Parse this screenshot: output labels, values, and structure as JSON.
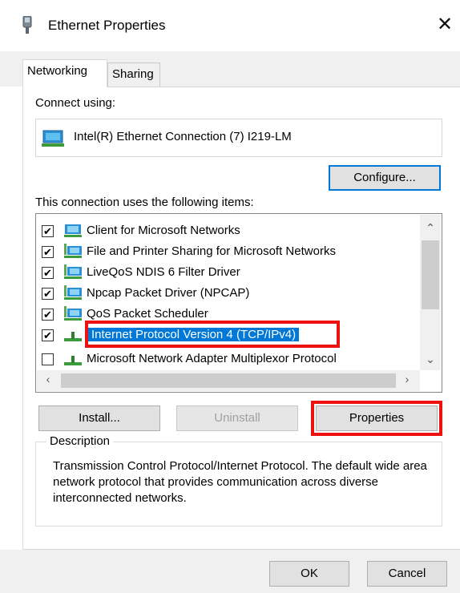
{
  "window": {
    "title": "Ethernet Properties",
    "close_glyph": "✕",
    "title_icon": "network-adapter-icon"
  },
  "tabs": [
    {
      "label": "Networking",
      "active": true
    },
    {
      "label": "Sharing",
      "active": false
    }
  ],
  "connect_using": {
    "label": "Connect using:",
    "adapter_name": "Intel(R) Ethernet Connection (7) I219-LM",
    "icon": "network-adapter-icon"
  },
  "configure_button": "Configure...",
  "items_label": "This connection uses the following items:",
  "items": [
    {
      "label": "Client for Microsoft Networks",
      "checked": true,
      "checkmark": "✔",
      "icon": "network-client-icon"
    },
    {
      "label": "File and Printer Sharing for Microsoft Networks",
      "checked": true,
      "checkmark": "✔",
      "icon": "network-service-icon"
    },
    {
      "label": "LiveQoS NDIS 6 Filter Driver",
      "checked": true,
      "checkmark": "✔",
      "icon": "network-service-icon"
    },
    {
      "label": "Npcap Packet Driver (NPCAP)",
      "checked": true,
      "checkmark": "✔",
      "icon": "network-service-icon"
    },
    {
      "label": "QoS Packet Scheduler",
      "checked": true,
      "checkmark": "✔",
      "icon": "network-service-icon"
    },
    {
      "label": "Internet Protocol Version 4 (TCP/IPv4)",
      "checked": true,
      "checkmark": "✔",
      "selected": true,
      "icon": "protocol-icon"
    },
    {
      "label": "Microsoft Network Adapter Multiplexor Protocol",
      "checked": false,
      "checkmark": "",
      "icon": "protocol-icon"
    }
  ],
  "scroll": {
    "up": "⌃",
    "down": "⌄",
    "left": "‹",
    "right": "›"
  },
  "buttons": {
    "install": "Install...",
    "uninstall": "Uninstall",
    "properties": "Properties",
    "ok": "OK",
    "cancel": "Cancel"
  },
  "description": {
    "label": "Description",
    "text": "Transmission Control Protocol/Internet Protocol. The default wide area network protocol that provides communication across diverse interconnected networks."
  },
  "colors": {
    "highlight_outline": "#ee1111",
    "selection": "#0078d7"
  }
}
